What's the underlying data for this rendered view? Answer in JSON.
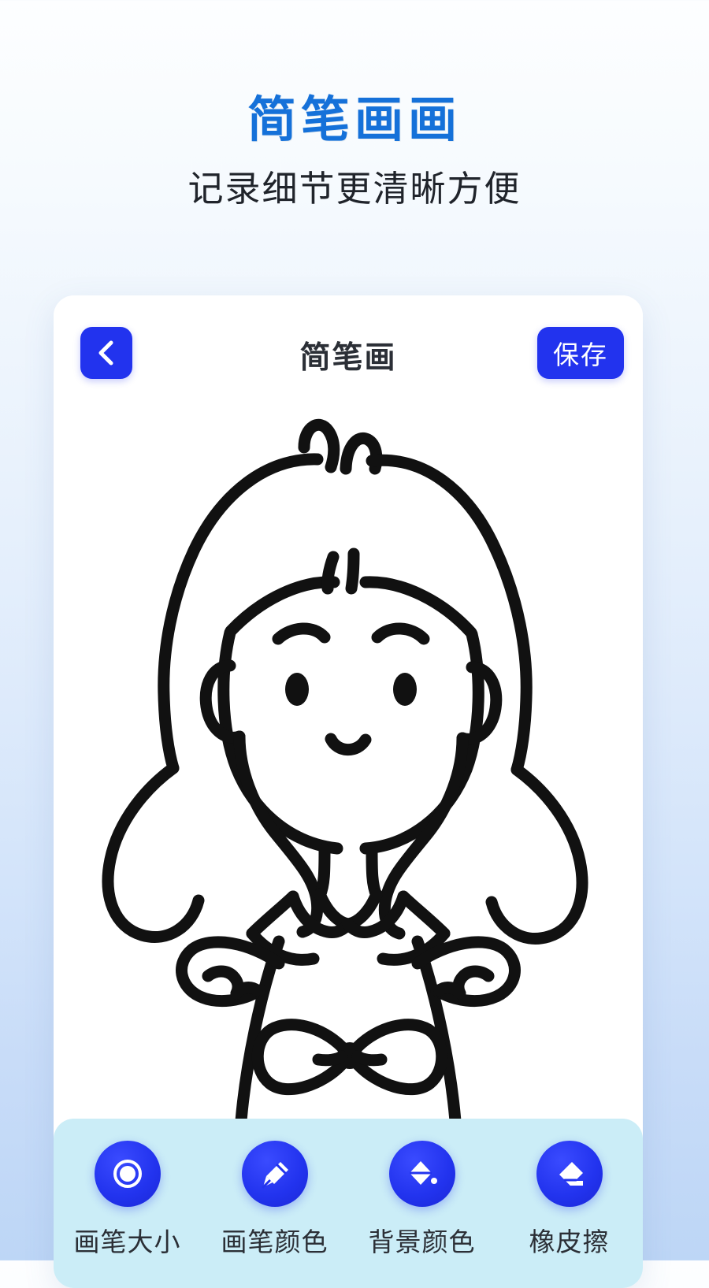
{
  "promo": {
    "title": "简笔画画",
    "subtitle": "记录细节更清晰方便",
    "title_color": "#1571d9",
    "subtitle_color": "#20242b"
  },
  "app": {
    "header": {
      "back_icon": "chevron-left-icon",
      "title": "简笔画",
      "save_label": "保存",
      "accent_color": "#2233ee"
    },
    "canvas": {
      "background_color": "#ffffff",
      "stroke_color": "#111111",
      "drawing_description": "简笔画女孩",
      "elements": [
        "头发",
        "刘海",
        "呆毛",
        "眉毛",
        "眼睛",
        "嘴巴",
        "耳朵",
        "脖子",
        "衣领",
        "裙子",
        "袖子",
        "蝴蝶结"
      ]
    },
    "toolbar": {
      "background_color": "#cbedf7",
      "tools": [
        {
          "icon": "brush-size-circle-icon",
          "label": "画笔大小"
        },
        {
          "icon": "pen-nib-icon",
          "label": "画笔颜色"
        },
        {
          "icon": "paint-bucket-icon",
          "label": "背景颜色"
        },
        {
          "icon": "eraser-icon",
          "label": "橡皮擦"
        }
      ]
    }
  }
}
